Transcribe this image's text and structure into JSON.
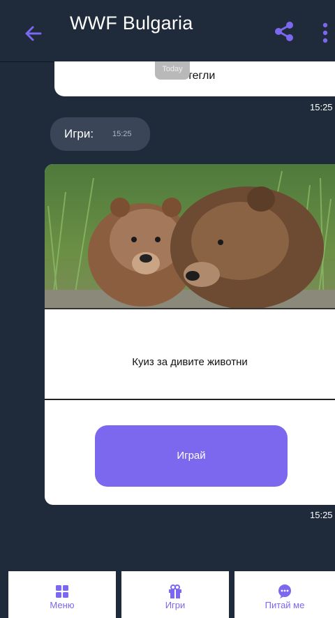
{
  "header": {
    "title": "WWF Bulgaria",
    "back_icon": "arrow-left-icon",
    "share_icon": "share-icon",
    "more_icon": "more-vertical-icon"
  },
  "messages": {
    "top_bubble_text": "Изтегли",
    "day_divider": "Today",
    "top_bubble_time": "15:25",
    "games_label": "Игри:",
    "games_time": "15:25",
    "card": {
      "title": "Куиз за дивите животни",
      "button_label": "Играй",
      "time": "15:25"
    }
  },
  "bottom_nav": [
    {
      "label": "Меню",
      "icon": "grid-icon"
    },
    {
      "label": "Игри",
      "icon": "gift-icon"
    },
    {
      "label": "Питай ме",
      "icon": "chat-icon"
    }
  ],
  "colors": {
    "background": "#1f2a3a",
    "accent": "#7b68ee",
    "bubble": "#3a4658"
  }
}
